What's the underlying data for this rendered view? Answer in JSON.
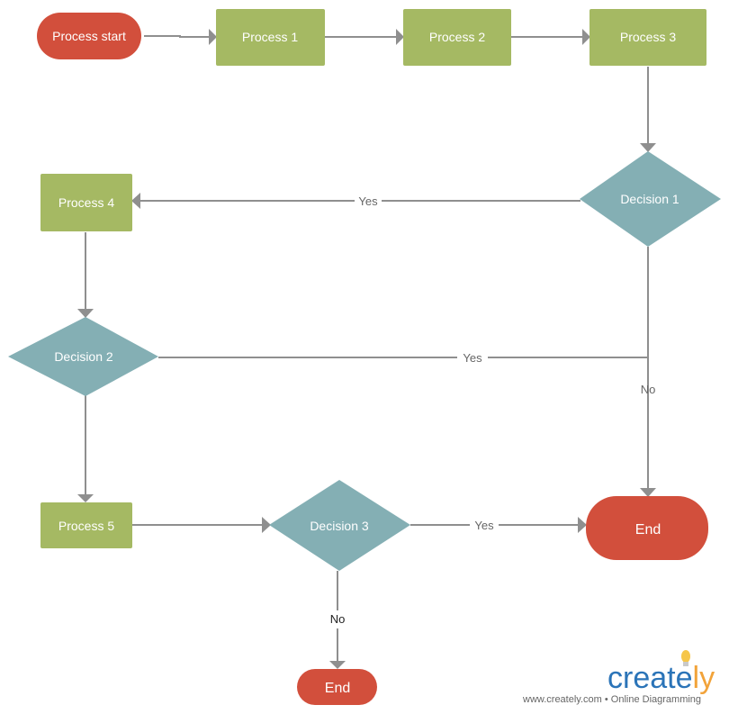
{
  "colors": {
    "terminal": "#d24f3c",
    "process": "#a5b963",
    "decision": "#84afb4",
    "connector": "#8f8f8f",
    "label": "#666666",
    "logo_blue": "#2b74b8",
    "logo_orange": "#f2a33a",
    "logo_bulb": "#f6c64a"
  },
  "nodes": {
    "start": {
      "label": "Process start",
      "type": "terminal"
    },
    "p1": {
      "label": "Process 1",
      "type": "process"
    },
    "p2": {
      "label": "Process 2",
      "type": "process"
    },
    "p3": {
      "label": "Process 3",
      "type": "process"
    },
    "d1": {
      "label": "Decision 1",
      "type": "decision"
    },
    "p4": {
      "label": "Process 4",
      "type": "process"
    },
    "d2": {
      "label": "Decision 2",
      "type": "decision"
    },
    "p5": {
      "label": "Process 5",
      "type": "process"
    },
    "d3": {
      "label": "Decision 3",
      "type": "decision"
    },
    "end1": {
      "label": "End",
      "type": "terminal"
    },
    "end2": {
      "label": "End",
      "type": "terminal"
    }
  },
  "edges": [
    {
      "from": "start",
      "to": "p1",
      "label": ""
    },
    {
      "from": "p1",
      "to": "p2",
      "label": ""
    },
    {
      "from": "p2",
      "to": "p3",
      "label": ""
    },
    {
      "from": "p3",
      "to": "d1",
      "label": ""
    },
    {
      "from": "d1",
      "to": "p4",
      "label": "Yes"
    },
    {
      "from": "d1",
      "to": "end1",
      "label": "No"
    },
    {
      "from": "p4",
      "to": "d2",
      "label": ""
    },
    {
      "from": "d2",
      "to": "d1-end1-line",
      "label": "Yes"
    },
    {
      "from": "d2",
      "to": "p5",
      "label": ""
    },
    {
      "from": "p5",
      "to": "d3",
      "label": ""
    },
    {
      "from": "d3",
      "to": "end1",
      "label": "Yes"
    },
    {
      "from": "d3",
      "to": "end2",
      "label": "No"
    }
  ],
  "edge_labels": {
    "d1_yes": "Yes",
    "d1_no": "No",
    "d2_yes": "Yes",
    "d3_yes": "Yes",
    "d3_no": "No"
  },
  "branding": {
    "logo_main": "creat",
    "logo_l": "e",
    "logo_accent": "ly",
    "tagline": "www.creately.com • Online Diagramming"
  }
}
